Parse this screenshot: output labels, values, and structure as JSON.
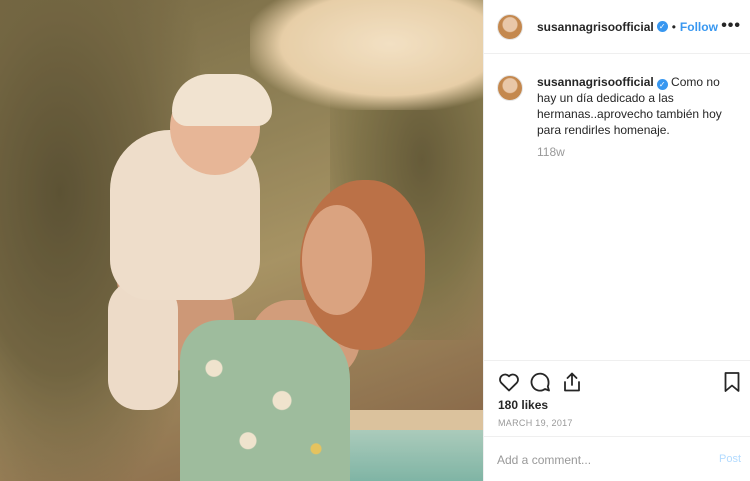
{
  "post": {
    "username": "susannagrisoofficial",
    "verified_icon": "verified-badge-icon",
    "separator": "•",
    "follow_label": "Follow",
    "more_label": "•••",
    "caption_text": "Como no hay un día dedicado a las hermanas..aprovecho también hoy para rendirles homenaje.",
    "time_ago": "118w",
    "likes": "180 likes",
    "date": "MARCH 19, 2017"
  },
  "actions": {
    "like_icon": "heart-icon",
    "comment_icon": "comment-icon",
    "share_icon": "share-icon",
    "save_icon": "bookmark-icon"
  },
  "comment": {
    "placeholder": "Add a comment...",
    "post_label": "Post"
  },
  "colors": {
    "accent": "#3897f0",
    "muted": "#999999",
    "post_disabled": "#b3dbff"
  }
}
